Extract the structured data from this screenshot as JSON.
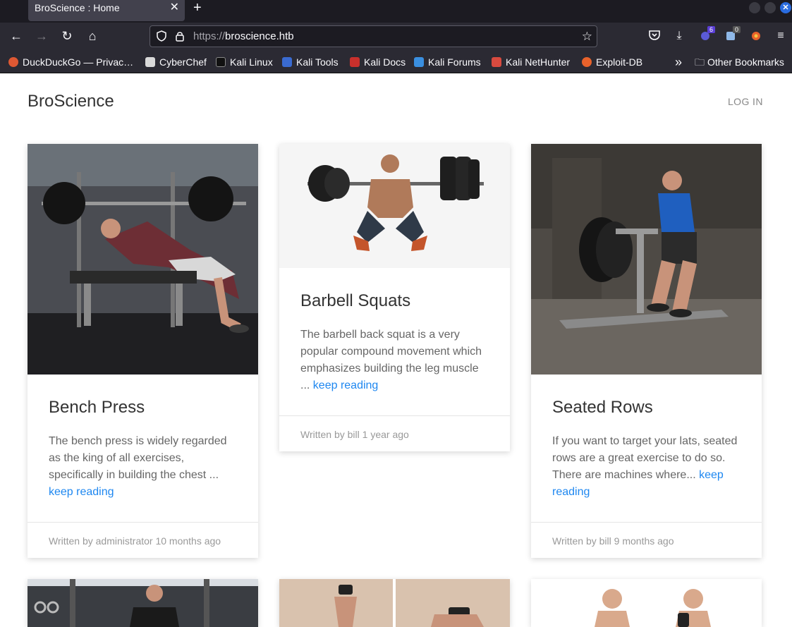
{
  "browser": {
    "tab_title": "BroScience : Home",
    "tab_close": "✕",
    "new_tab": "+",
    "url_protocol": "https://",
    "url_host": "broscience.htb",
    "badges": {
      "extensions": "6",
      "notes": "0"
    },
    "bookmarks": [
      {
        "label": "DuckDuckGo — Privac…",
        "color": "#de5833"
      },
      {
        "label": "CyberChef",
        "color": "#d9d9d9"
      },
      {
        "label": "Kali Linux",
        "color": "#2b2a33"
      },
      {
        "label": "Kali Tools",
        "color": "#3a6bd1"
      },
      {
        "label": "Kali Docs",
        "color": "#c9302c"
      },
      {
        "label": "Kali Forums",
        "color": "#3a8fe0"
      },
      {
        "label": "Kali NetHunter",
        "color": "#d84a3f"
      },
      {
        "label": "Exploit-DB",
        "color": "#e8622b"
      }
    ],
    "overflow_label": "»",
    "other_bookmarks": "Other Bookmarks"
  },
  "site": {
    "brand": "BroScience",
    "login": "LOG IN"
  },
  "posts": [
    {
      "title": "Bench Press",
      "excerpt": "The bench press is widely regarded as the king of all exercises, specifically in building the chest ...",
      "link": "keep reading",
      "meta": "Written by administrator 10 months ago"
    },
    {
      "title": "Barbell Squats",
      "excerpt": "The barbell back squat is a very popular compound movement which emphasizes building the leg muscle ...",
      "link": "keep reading",
      "meta": "Written by bill 1 year ago"
    },
    {
      "title": "Seated Rows",
      "excerpt": "If you want to target your lats, seated rows are a great exercise to do so. There are machines where...",
      "link": "keep reading",
      "meta": "Written by bill 9 months ago"
    }
  ],
  "colors": {
    "accent": "#1e87f0",
    "chrome_dark": "#1c1b22",
    "chrome": "#2b2a33"
  }
}
